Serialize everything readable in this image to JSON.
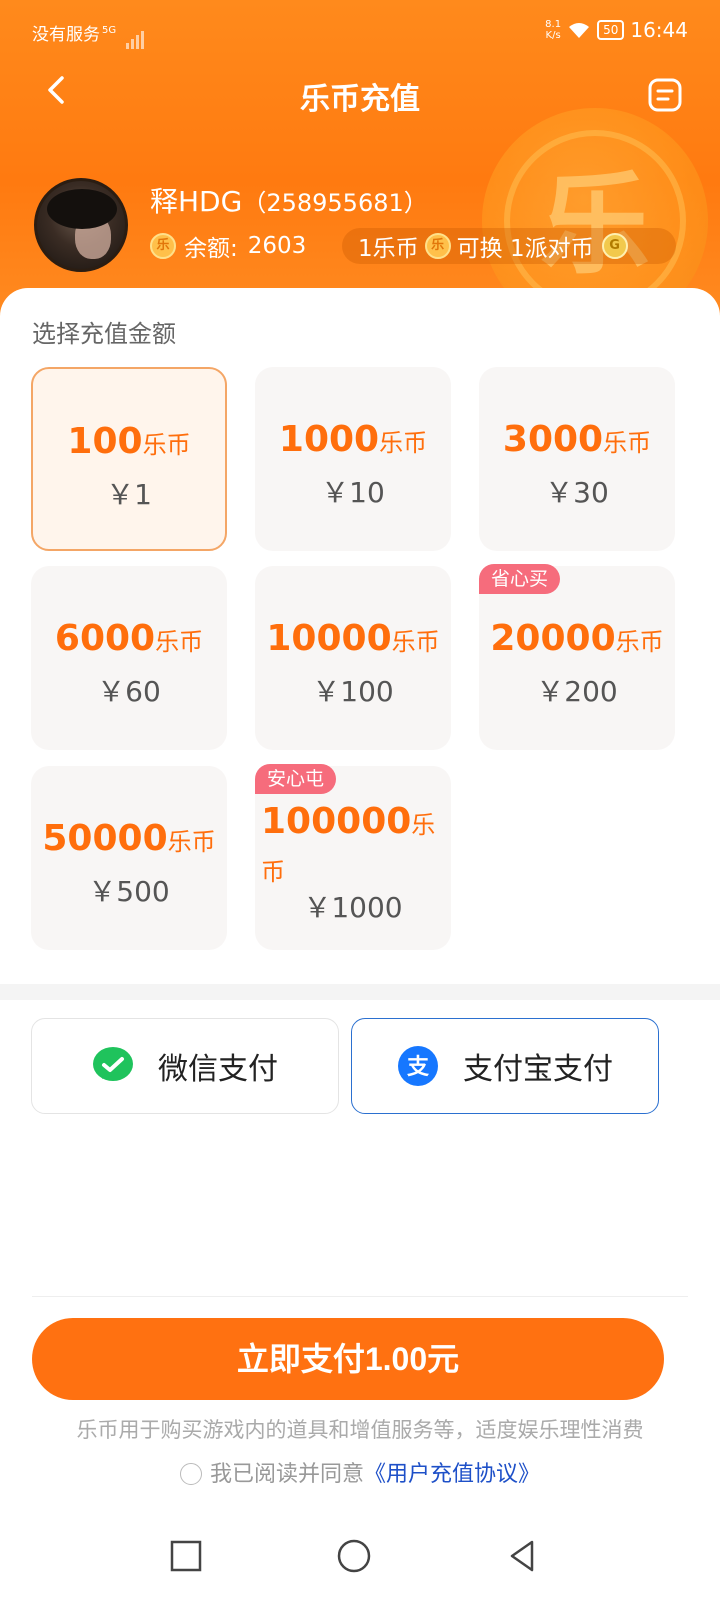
{
  "status_bar": {
    "carrier": "没有服务",
    "network": "5G",
    "net_speed_value": "8.1",
    "net_speed_unit": "K/s",
    "battery": "50",
    "time": "16:44"
  },
  "nav": {
    "title": "乐币充值"
  },
  "user": {
    "name": "释HDG",
    "uid": "（258955681）",
    "balance_label": "余额:",
    "balance_value": "2603",
    "exchange_left": "1乐币",
    "exchange_middle": "可换 1派对币"
  },
  "coin_icon_char": "乐",
  "pai_coin_char": "G",
  "section_label": "选择充值金额",
  "coin_unit": "乐币",
  "options": [
    {
      "coins": "100",
      "price": "￥1",
      "tag": "",
      "selected": true
    },
    {
      "coins": "1000",
      "price": "￥10",
      "tag": ""
    },
    {
      "coins": "3000",
      "price": "￥30",
      "tag": ""
    },
    {
      "coins": "6000",
      "price": "￥60",
      "tag": ""
    },
    {
      "coins": "10000",
      "price": "￥100",
      "tag": ""
    },
    {
      "coins": "20000",
      "price": "￥200",
      "tag": "省心买"
    },
    {
      "coins": "50000",
      "price": "￥500",
      "tag": ""
    },
    {
      "coins": "100000",
      "price": "￥1000",
      "tag": "安心屯"
    }
  ],
  "payment": {
    "wechat_label": "微信支付",
    "alipay_label": "支付宝支付",
    "alipay_icon_char": "支",
    "selected": "alipay"
  },
  "pay_button_label": "立即支付1.00元",
  "notice": "乐币用于购买游戏内的道具和增值服务等，适度娱乐理性消费",
  "agreement": {
    "prefix": "我已阅读并同意",
    "link": "《用户充值协议》",
    "checked": false
  },
  "colors": {
    "accent": "#ff7111",
    "coin_text": "#ff6e0c",
    "tag": "#f66c7c",
    "link": "#1e50c8"
  }
}
